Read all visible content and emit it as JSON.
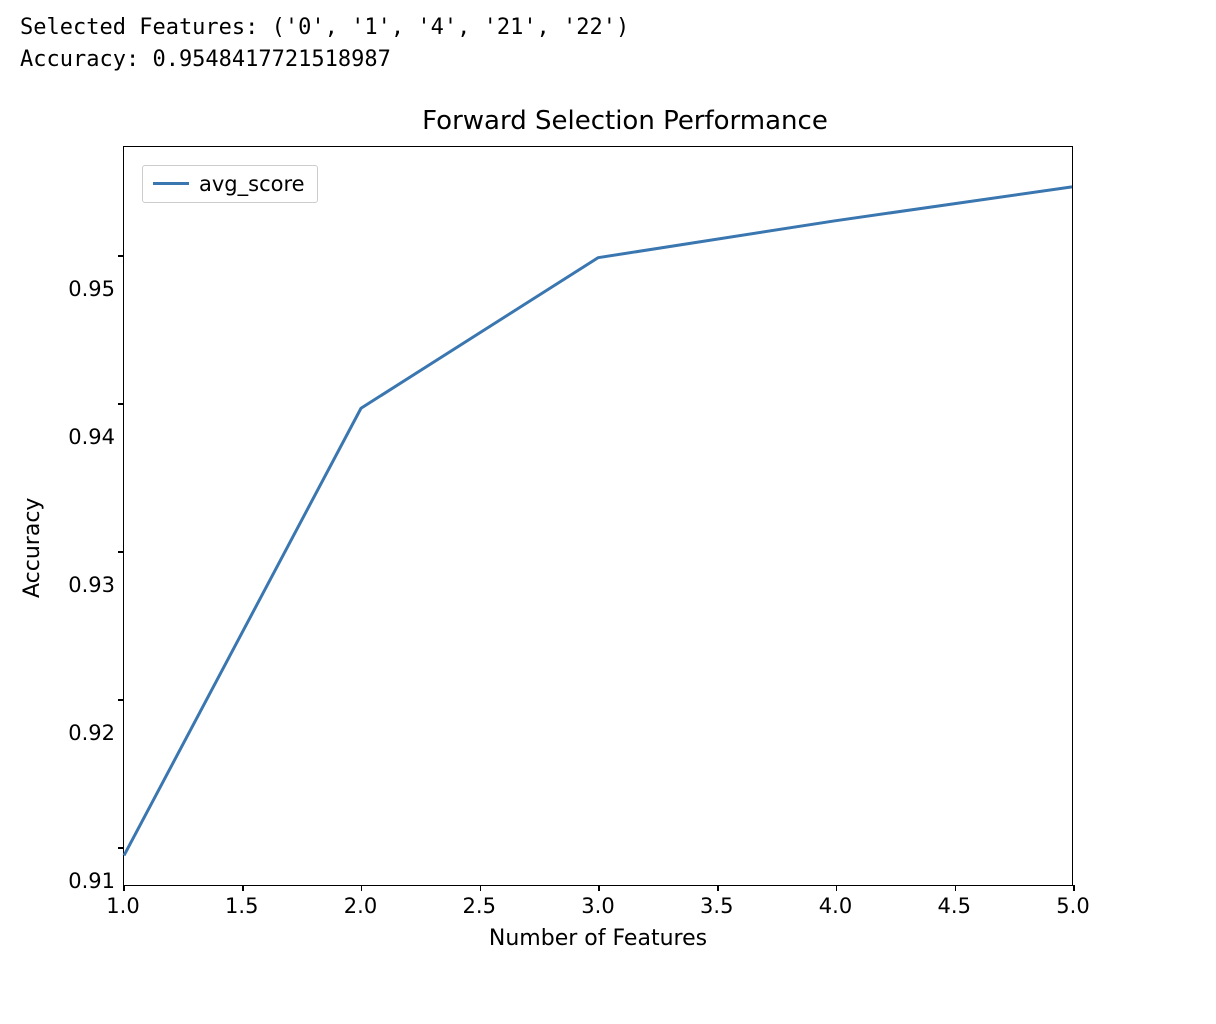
{
  "console": {
    "line1": "Selected Features: ('0', '1', '4', '21', '22')",
    "line2": "Accuracy: 0.9548417721518987"
  },
  "chart_data": {
    "type": "line",
    "title": "Forward Selection Performance",
    "xlabel": "Number of Features",
    "ylabel": "Accuracy",
    "x": [
      1,
      2,
      3,
      4,
      5
    ],
    "series": [
      {
        "name": "avg_score",
        "values": [
          0.9095,
          0.9398,
          0.95,
          0.9525,
          0.9548
        ]
      }
    ],
    "xlim": [
      1.0,
      5.0
    ],
    "xticks": [
      1.0,
      1.5,
      2.0,
      2.5,
      3.0,
      3.5,
      4.0,
      4.5,
      5.0
    ],
    "xtick_labels": [
      "1.0",
      "1.5",
      "2.0",
      "2.5",
      "3.0",
      "3.5",
      "4.0",
      "4.5",
      "5.0"
    ],
    "ylim": [
      0.9075,
      0.9575
    ],
    "yticks": [
      0.91,
      0.92,
      0.93,
      0.94,
      0.95
    ],
    "ytick_labels": [
      "0.91",
      "0.92",
      "0.93",
      "0.94",
      "0.95"
    ],
    "legend_position": "upper left",
    "line_color": "#3a76af"
  }
}
